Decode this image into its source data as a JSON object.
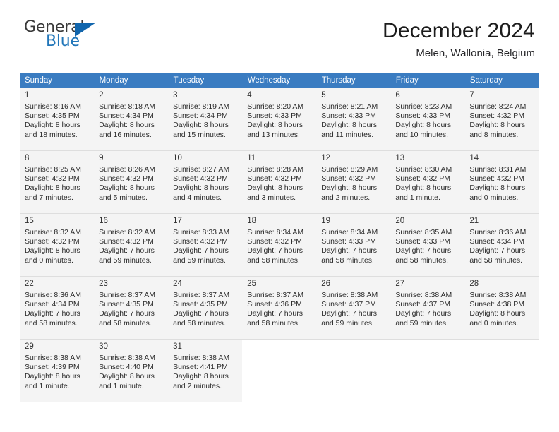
{
  "brand": {
    "name_top": "General",
    "name_bottom": "Blue",
    "triangle_color": "#1266ad",
    "blue_color": "#2176b9"
  },
  "header": {
    "title": "December 2024",
    "subtitle": "Melen, Wallonia, Belgium"
  },
  "theme": {
    "header_blue": "#3a7cc1",
    "row_shade": "#f4f4f4",
    "grid_line": "#dedede"
  },
  "weekdays": [
    "Sunday",
    "Monday",
    "Tuesday",
    "Wednesday",
    "Thursday",
    "Friday",
    "Saturday"
  ],
  "labels": {
    "sunrise_prefix": "Sunrise:",
    "sunset_prefix": "Sunset:",
    "daylight_prefix": "Daylight:"
  },
  "weeks": [
    [
      {
        "day": "1",
        "sunrise": "Sunrise: 8:16 AM",
        "sunset": "Sunset: 4:35 PM",
        "daylight1": "Daylight: 8 hours",
        "daylight2": "and 18 minutes."
      },
      {
        "day": "2",
        "sunrise": "Sunrise: 8:18 AM",
        "sunset": "Sunset: 4:34 PM",
        "daylight1": "Daylight: 8 hours",
        "daylight2": "and 16 minutes."
      },
      {
        "day": "3",
        "sunrise": "Sunrise: 8:19 AM",
        "sunset": "Sunset: 4:34 PM",
        "daylight1": "Daylight: 8 hours",
        "daylight2": "and 15 minutes."
      },
      {
        "day": "4",
        "sunrise": "Sunrise: 8:20 AM",
        "sunset": "Sunset: 4:33 PM",
        "daylight1": "Daylight: 8 hours",
        "daylight2": "and 13 minutes."
      },
      {
        "day": "5",
        "sunrise": "Sunrise: 8:21 AM",
        "sunset": "Sunset: 4:33 PM",
        "daylight1": "Daylight: 8 hours",
        "daylight2": "and 11 minutes."
      },
      {
        "day": "6",
        "sunrise": "Sunrise: 8:23 AM",
        "sunset": "Sunset: 4:33 PM",
        "daylight1": "Daylight: 8 hours",
        "daylight2": "and 10 minutes."
      },
      {
        "day": "7",
        "sunrise": "Sunrise: 8:24 AM",
        "sunset": "Sunset: 4:32 PM",
        "daylight1": "Daylight: 8 hours",
        "daylight2": "and 8 minutes."
      }
    ],
    [
      {
        "day": "8",
        "sunrise": "Sunrise: 8:25 AM",
        "sunset": "Sunset: 4:32 PM",
        "daylight1": "Daylight: 8 hours",
        "daylight2": "and 7 minutes."
      },
      {
        "day": "9",
        "sunrise": "Sunrise: 8:26 AM",
        "sunset": "Sunset: 4:32 PM",
        "daylight1": "Daylight: 8 hours",
        "daylight2": "and 5 minutes."
      },
      {
        "day": "10",
        "sunrise": "Sunrise: 8:27 AM",
        "sunset": "Sunset: 4:32 PM",
        "daylight1": "Daylight: 8 hours",
        "daylight2": "and 4 minutes."
      },
      {
        "day": "11",
        "sunrise": "Sunrise: 8:28 AM",
        "sunset": "Sunset: 4:32 PM",
        "daylight1": "Daylight: 8 hours",
        "daylight2": "and 3 minutes."
      },
      {
        "day": "12",
        "sunrise": "Sunrise: 8:29 AM",
        "sunset": "Sunset: 4:32 PM",
        "daylight1": "Daylight: 8 hours",
        "daylight2": "and 2 minutes."
      },
      {
        "day": "13",
        "sunrise": "Sunrise: 8:30 AM",
        "sunset": "Sunset: 4:32 PM",
        "daylight1": "Daylight: 8 hours",
        "daylight2": "and 1 minute."
      },
      {
        "day": "14",
        "sunrise": "Sunrise: 8:31 AM",
        "sunset": "Sunset: 4:32 PM",
        "daylight1": "Daylight: 8 hours",
        "daylight2": "and 0 minutes."
      }
    ],
    [
      {
        "day": "15",
        "sunrise": "Sunrise: 8:32 AM",
        "sunset": "Sunset: 4:32 PM",
        "daylight1": "Daylight: 8 hours",
        "daylight2": "and 0 minutes."
      },
      {
        "day": "16",
        "sunrise": "Sunrise: 8:32 AM",
        "sunset": "Sunset: 4:32 PM",
        "daylight1": "Daylight: 7 hours",
        "daylight2": "and 59 minutes."
      },
      {
        "day": "17",
        "sunrise": "Sunrise: 8:33 AM",
        "sunset": "Sunset: 4:32 PM",
        "daylight1": "Daylight: 7 hours",
        "daylight2": "and 59 minutes."
      },
      {
        "day": "18",
        "sunrise": "Sunrise: 8:34 AM",
        "sunset": "Sunset: 4:32 PM",
        "daylight1": "Daylight: 7 hours",
        "daylight2": "and 58 minutes."
      },
      {
        "day": "19",
        "sunrise": "Sunrise: 8:34 AM",
        "sunset": "Sunset: 4:33 PM",
        "daylight1": "Daylight: 7 hours",
        "daylight2": "and 58 minutes."
      },
      {
        "day": "20",
        "sunrise": "Sunrise: 8:35 AM",
        "sunset": "Sunset: 4:33 PM",
        "daylight1": "Daylight: 7 hours",
        "daylight2": "and 58 minutes."
      },
      {
        "day": "21",
        "sunrise": "Sunrise: 8:36 AM",
        "sunset": "Sunset: 4:34 PM",
        "daylight1": "Daylight: 7 hours",
        "daylight2": "and 58 minutes."
      }
    ],
    [
      {
        "day": "22",
        "sunrise": "Sunrise: 8:36 AM",
        "sunset": "Sunset: 4:34 PM",
        "daylight1": "Daylight: 7 hours",
        "daylight2": "and 58 minutes."
      },
      {
        "day": "23",
        "sunrise": "Sunrise: 8:37 AM",
        "sunset": "Sunset: 4:35 PM",
        "daylight1": "Daylight: 7 hours",
        "daylight2": "and 58 minutes."
      },
      {
        "day": "24",
        "sunrise": "Sunrise: 8:37 AM",
        "sunset": "Sunset: 4:35 PM",
        "daylight1": "Daylight: 7 hours",
        "daylight2": "and 58 minutes."
      },
      {
        "day": "25",
        "sunrise": "Sunrise: 8:37 AM",
        "sunset": "Sunset: 4:36 PM",
        "daylight1": "Daylight: 7 hours",
        "daylight2": "and 58 minutes."
      },
      {
        "day": "26",
        "sunrise": "Sunrise: 8:38 AM",
        "sunset": "Sunset: 4:37 PM",
        "daylight1": "Daylight: 7 hours",
        "daylight2": "and 59 minutes."
      },
      {
        "day": "27",
        "sunrise": "Sunrise: 8:38 AM",
        "sunset": "Sunset: 4:37 PM",
        "daylight1": "Daylight: 7 hours",
        "daylight2": "and 59 minutes."
      },
      {
        "day": "28",
        "sunrise": "Sunrise: 8:38 AM",
        "sunset": "Sunset: 4:38 PM",
        "daylight1": "Daylight: 8 hours",
        "daylight2": "and 0 minutes."
      }
    ],
    [
      {
        "day": "29",
        "sunrise": "Sunrise: 8:38 AM",
        "sunset": "Sunset: 4:39 PM",
        "daylight1": "Daylight: 8 hours",
        "daylight2": "and 1 minute."
      },
      {
        "day": "30",
        "sunrise": "Sunrise: 8:38 AM",
        "sunset": "Sunset: 4:40 PM",
        "daylight1": "Daylight: 8 hours",
        "daylight2": "and 1 minute."
      },
      {
        "day": "31",
        "sunrise": "Sunrise: 8:38 AM",
        "sunset": "Sunset: 4:41 PM",
        "daylight1": "Daylight: 8 hours",
        "daylight2": "and 2 minutes."
      },
      {
        "day": "",
        "sunrise": "",
        "sunset": "",
        "daylight1": "",
        "daylight2": ""
      },
      {
        "day": "",
        "sunrise": "",
        "sunset": "",
        "daylight1": "",
        "daylight2": ""
      },
      {
        "day": "",
        "sunrise": "",
        "sunset": "",
        "daylight1": "",
        "daylight2": ""
      },
      {
        "day": "",
        "sunrise": "",
        "sunset": "",
        "daylight1": "",
        "daylight2": ""
      }
    ]
  ]
}
